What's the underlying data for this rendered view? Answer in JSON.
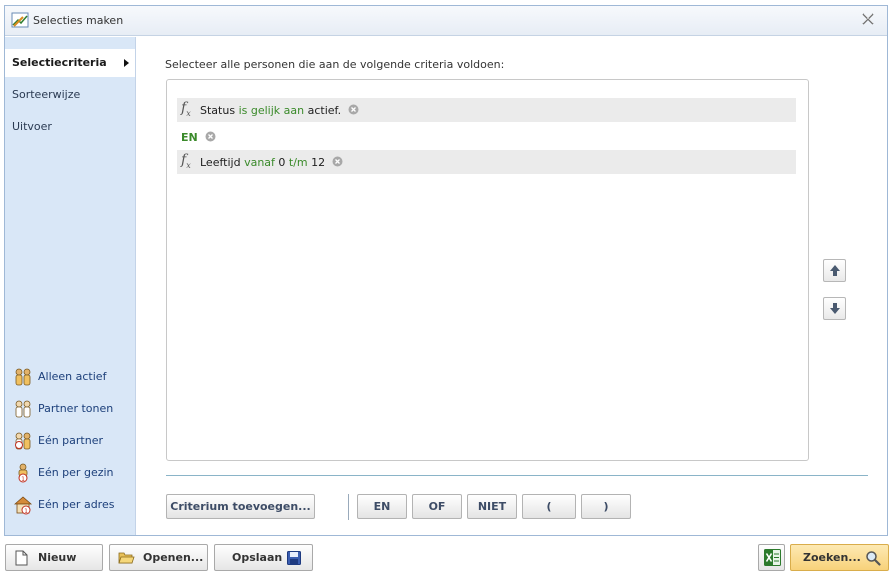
{
  "window": {
    "title": "Selecties maken"
  },
  "sidebar": {
    "nav": [
      {
        "label": "Selectiecriteria",
        "active": true
      },
      {
        "label": "Sorteerwijze",
        "active": false
      },
      {
        "label": "Uitvoer",
        "active": false
      }
    ],
    "options": [
      {
        "label": "Alleen actief",
        "icon": "people-active-icon"
      },
      {
        "label": "Partner tonen",
        "icon": "people-partner-icon"
      },
      {
        "label": "Eén partner",
        "icon": "people-one-partner-icon"
      },
      {
        "label": "Eén per gezin",
        "icon": "family-icon"
      },
      {
        "label": "Eén per adres",
        "icon": "address-icon"
      }
    ]
  },
  "main": {
    "instruction": "Selecteer alle personen die aan de volgende criteria voldoen:",
    "criteria": [
      {
        "field": "Status",
        "operator": "is gelijk aan",
        "value": "actief."
      },
      {
        "connector": "EN"
      },
      {
        "field": "Leeftijd",
        "operator": "vanaf",
        "value1": "0",
        "operator2": "t/m",
        "value2": "12"
      }
    ],
    "buttons": {
      "add_criterium": "Criterium toevoegen...",
      "en": "EN",
      "of": "OF",
      "niet": "NIET",
      "open_paren": "(",
      "close_paren": ")"
    }
  },
  "bottom": {
    "nieuw": "Nieuw",
    "openen": "Openen...",
    "opslaan": "Opslaan",
    "zoeken": "Zoeken..."
  },
  "colors": {
    "accent_green": "#3a8a2a",
    "sidebar_bg": "#d9e7f7",
    "zoeken_bg": "#f8d27a"
  }
}
